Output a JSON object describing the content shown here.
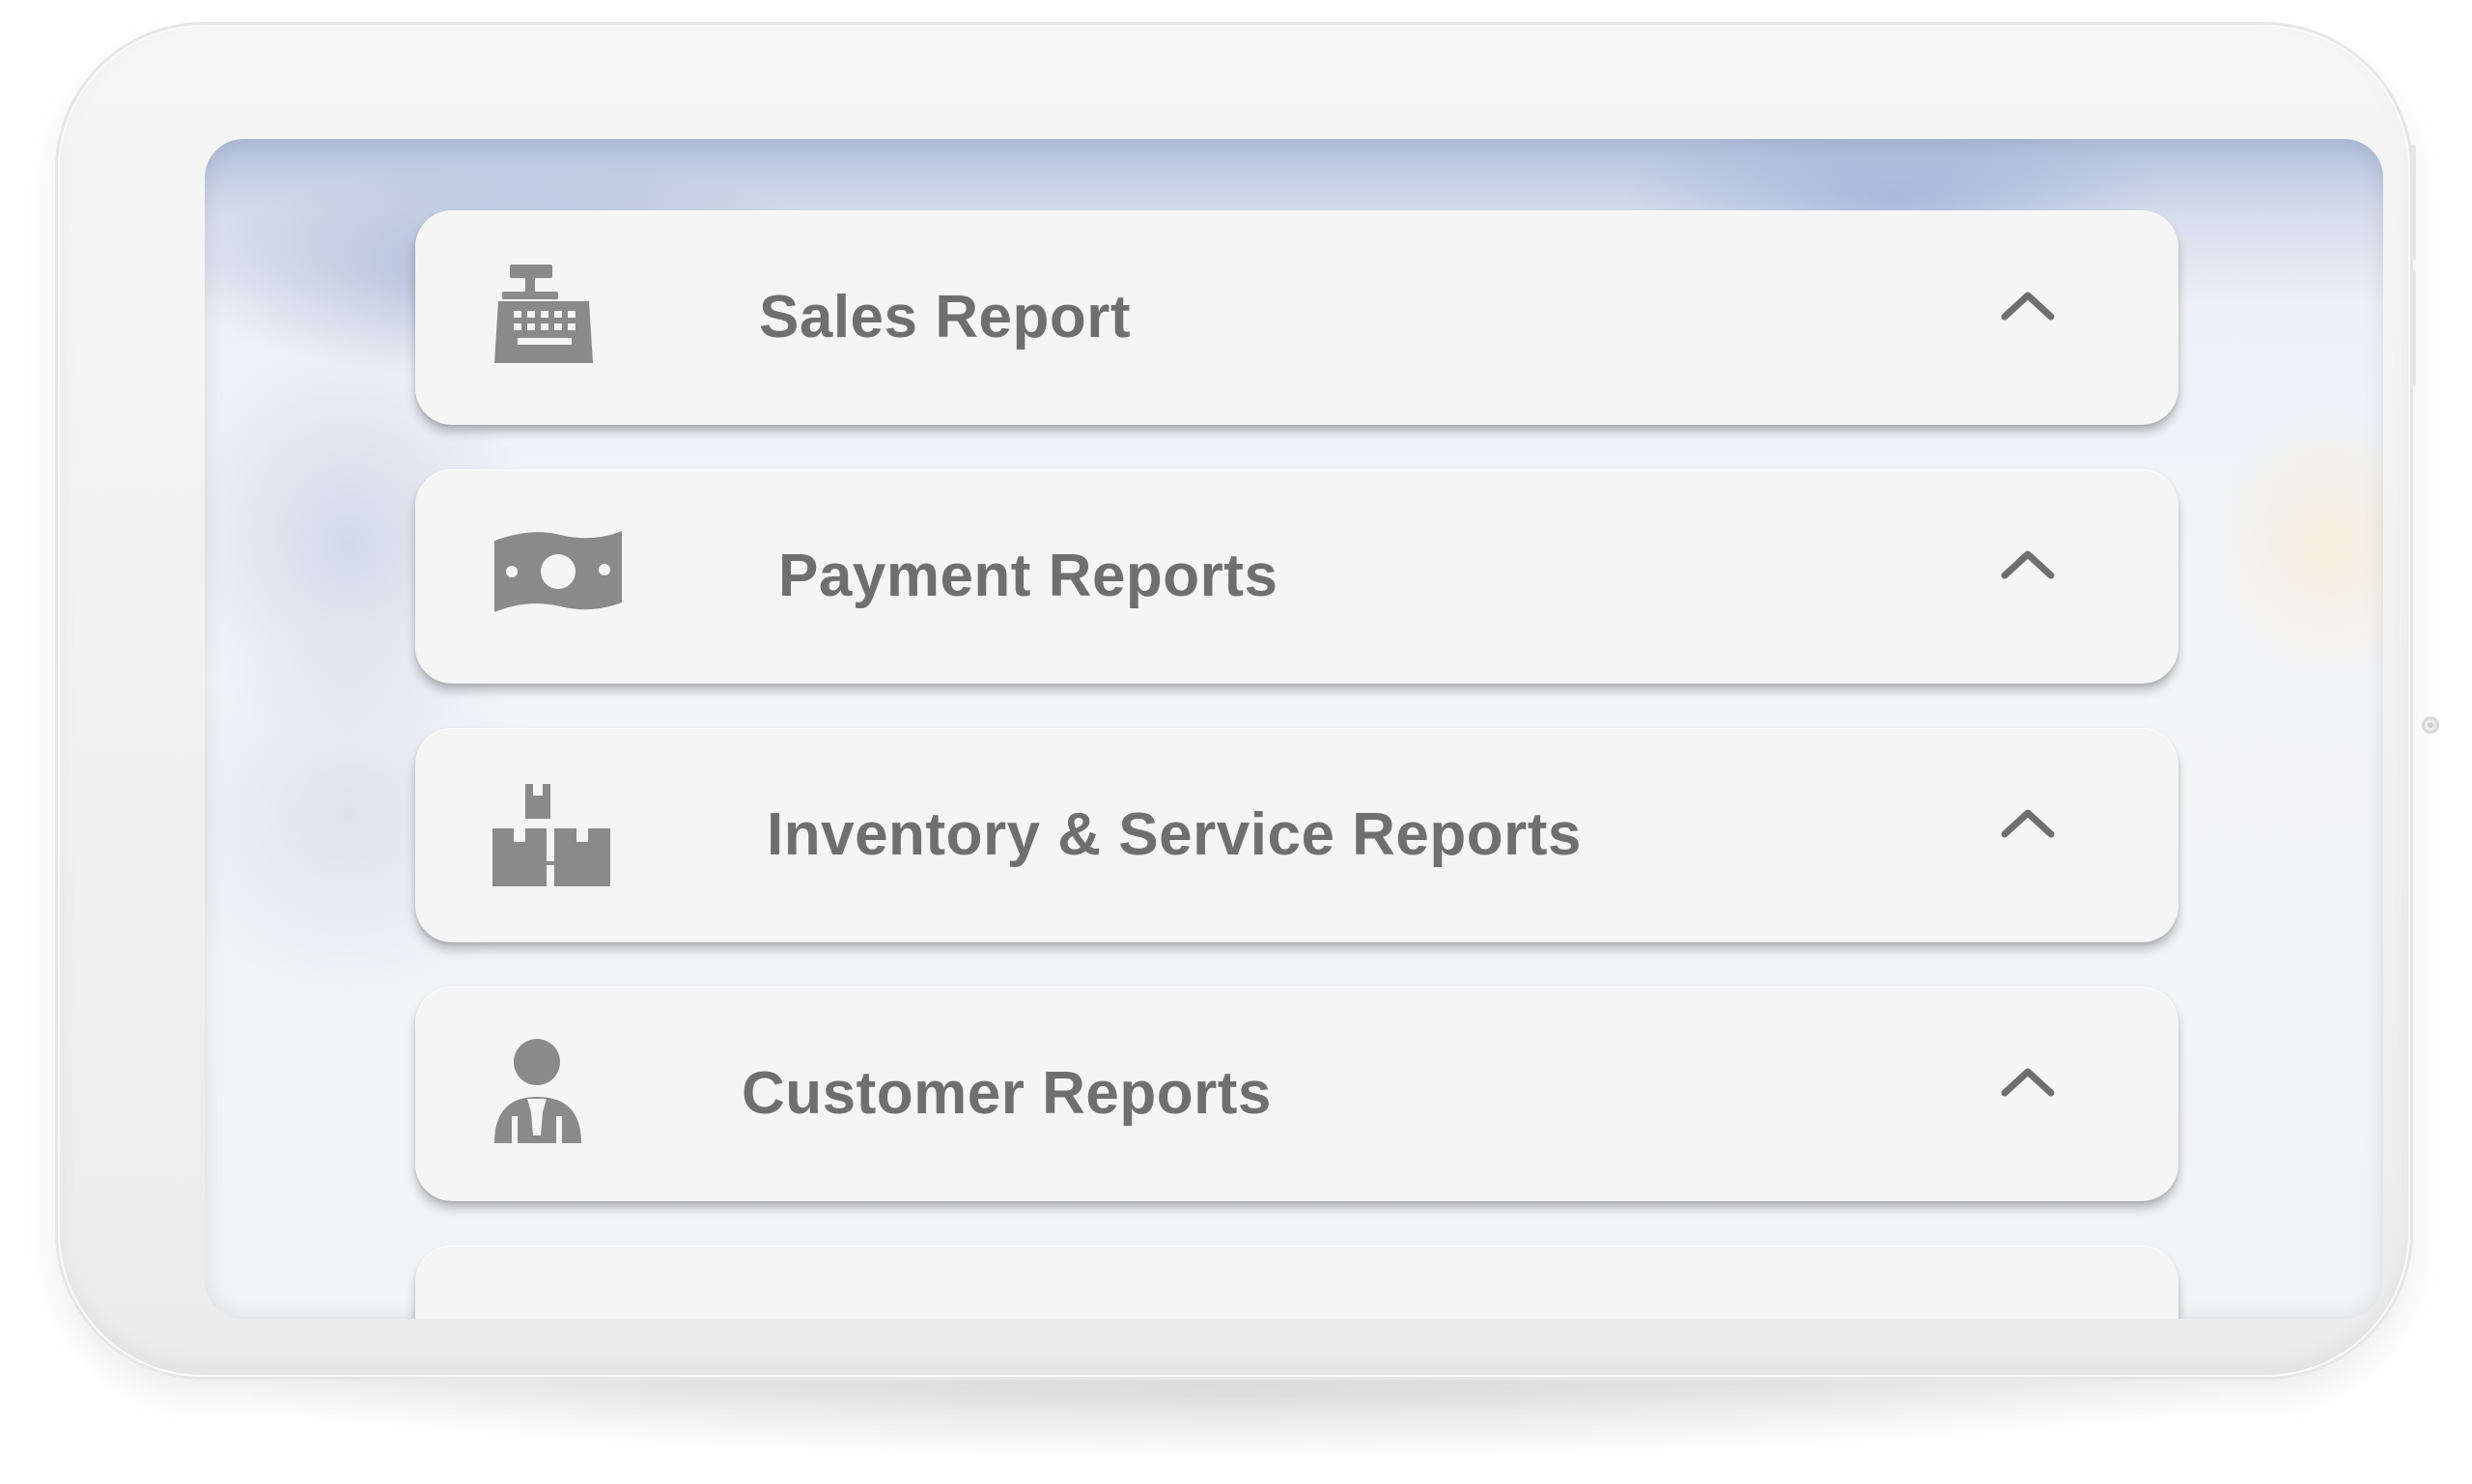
{
  "reports": [
    {
      "label": "Sales Report",
      "icon": "cash-register-icon",
      "expanded": true
    },
    {
      "label": "Payment Reports",
      "icon": "money-bill-icon",
      "expanded": true
    },
    {
      "label": "Inventory & Service Reports",
      "icon": "boxes-icon",
      "expanded": true
    },
    {
      "label": "Customer Reports",
      "icon": "user-tie-icon",
      "expanded": true
    }
  ],
  "colors": {
    "card_background": "#f5f5f5",
    "label_text": "#6f6f6f",
    "icon": "#8a8a8a",
    "device_frame": "#f0f0f0"
  }
}
